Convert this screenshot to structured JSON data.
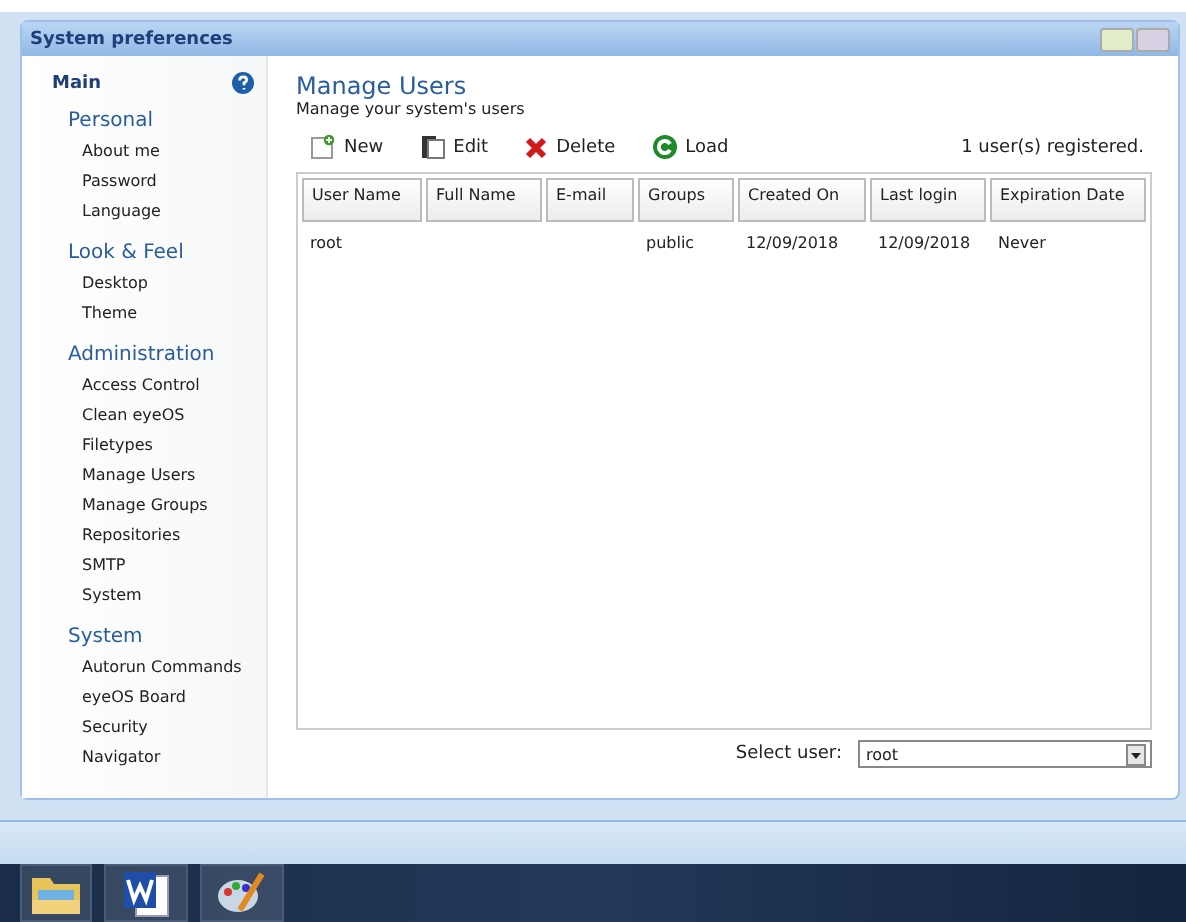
{
  "window": {
    "title": "System preferences"
  },
  "sidebar": {
    "header": "Main",
    "groups": [
      {
        "title": "Personal",
        "items": [
          "About me",
          "Password",
          "Language"
        ]
      },
      {
        "title": "Look & Feel",
        "items": [
          "Desktop",
          "Theme"
        ]
      },
      {
        "title": "Administration",
        "items": [
          "Access Control",
          "Clean eyeOS",
          "Filetypes",
          "Manage Users",
          "Manage Groups",
          "Repositories",
          "SMTP",
          "System"
        ]
      },
      {
        "title": "System",
        "items": [
          "Autorun Commands",
          "eyeOS Board",
          "Security",
          "Navigator"
        ]
      }
    ]
  },
  "content": {
    "title": "Manage Users",
    "subtitle": "Manage your system's users",
    "toolbar": [
      {
        "kind": "new",
        "label": "New"
      },
      {
        "kind": "edit",
        "label": "Edit"
      },
      {
        "kind": "delete",
        "label": "Delete"
      },
      {
        "kind": "load",
        "label": "Load"
      }
    ],
    "count": "1 user(s) registered.",
    "table": {
      "columns": [
        "User Name",
        "Full Name",
        "E-mail",
        "Groups",
        "Created On",
        "Last login",
        "Expiration Date"
      ],
      "rows": [
        [
          "root",
          "",
          "",
          "public",
          "12/09/2018",
          "12/09/2018",
          "Never"
        ]
      ]
    },
    "select_label": "Select user:",
    "select_value": "root"
  },
  "taskbar": [
    {
      "kind": "folder"
    },
    {
      "kind": "word"
    },
    {
      "kind": "paint"
    }
  ]
}
